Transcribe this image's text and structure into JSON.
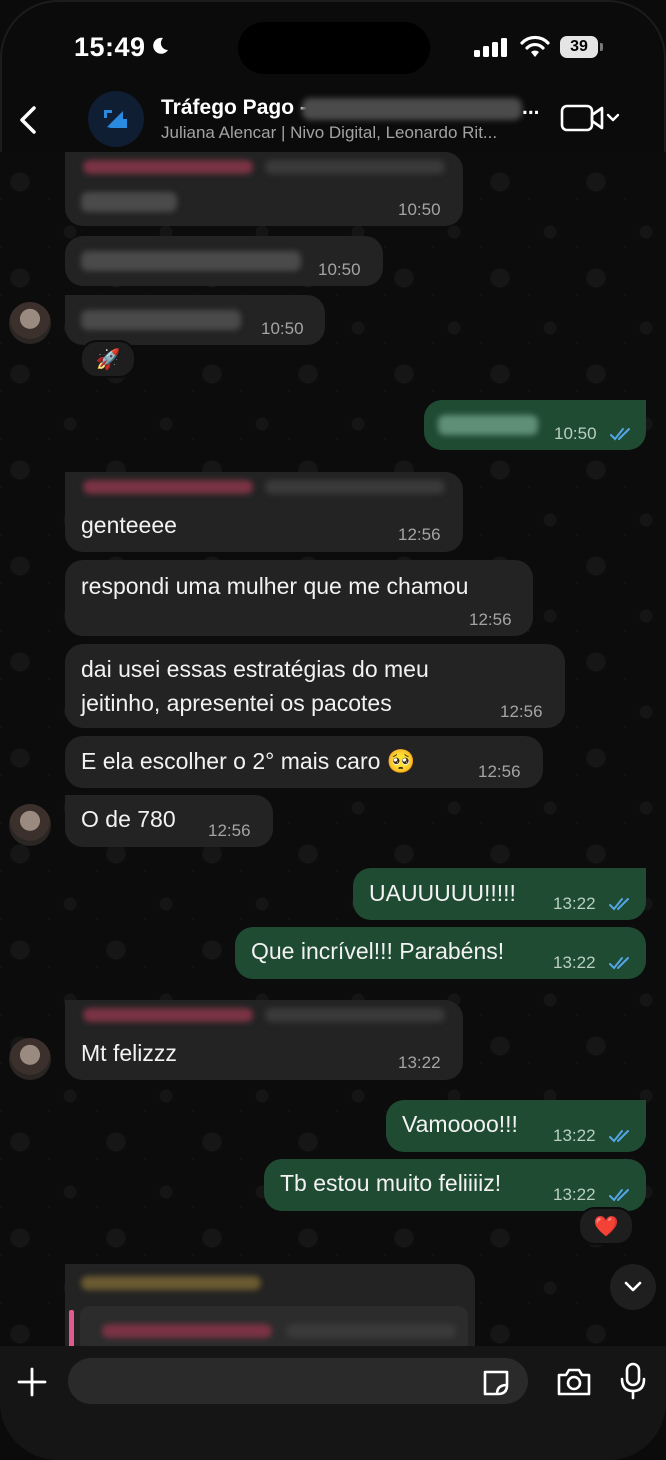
{
  "status_bar": {
    "time": "15:49",
    "battery": "39"
  },
  "header": {
    "title": "Tráfego Pago -",
    "title_ellipsis": "...",
    "participants": "Juliana Alencar | Nivo Digital, Leonardo Rit..."
  },
  "messages": [
    {
      "id": "m1",
      "time": "10:50"
    },
    {
      "id": "m2",
      "time": "10:50"
    },
    {
      "id": "m3",
      "time": "10:50",
      "reaction": "🚀"
    },
    {
      "id": "m4",
      "time": "10:50"
    },
    {
      "id": "m5",
      "text": "genteeee",
      "time": "12:56"
    },
    {
      "id": "m6",
      "text": "respondi uma mulher que me chamou",
      "time": "12:56"
    },
    {
      "id": "m7",
      "text_line1": "dai usei essas estratégias do meu",
      "text_line2": "jeitinho, apresentei os pacotes",
      "time": "12:56"
    },
    {
      "id": "m8",
      "text": "E ela escolher o 2° mais caro 🥺",
      "time": "12:56"
    },
    {
      "id": "m9",
      "text": "O de 780",
      "time": "12:56"
    },
    {
      "id": "m10",
      "text": "UAUUUUU!!!!!",
      "time": "13:22"
    },
    {
      "id": "m11",
      "text": "Que incrível!!! Parabéns!",
      "time": "13:22"
    },
    {
      "id": "m12",
      "text": "Mt felizzz",
      "time": "13:22"
    },
    {
      "id": "m13",
      "text": "Vamoooo!!!",
      "time": "13:22"
    },
    {
      "id": "m14",
      "text": "Tb estou muito feliiiiz!",
      "time": "13:22",
      "reaction": "❤️"
    }
  ],
  "input": {
    "placeholder": ""
  },
  "colors": {
    "incoming": "#232323",
    "outgoing": "#1f4b33",
    "ticks": "#53a6e6",
    "reply_bar": "#e05a8c"
  }
}
